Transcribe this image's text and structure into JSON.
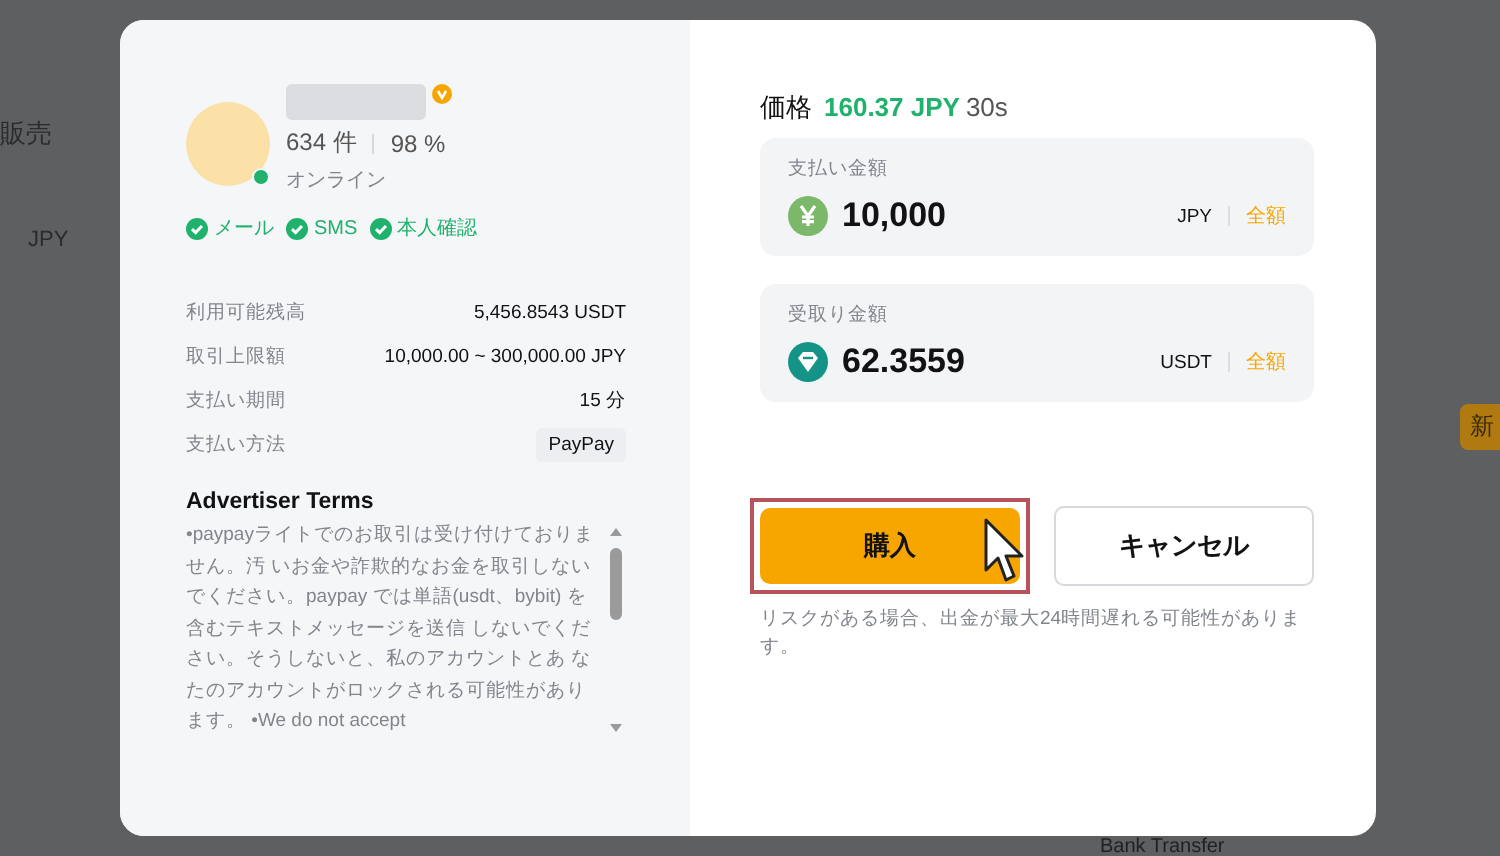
{
  "background_page": {
    "sell_tab": "販売",
    "currency": "JPY",
    "new_tag": "新",
    "payment_label": "Bank Transfer"
  },
  "advertiser": {
    "verified_badge": true,
    "online": true,
    "orders": "634 件",
    "completion": "98 %",
    "status": "オンライン",
    "verifications": [
      {
        "label": "メール",
        "verified": true
      },
      {
        "label": "SMS",
        "verified": true
      },
      {
        "label": "本人確認",
        "verified": true
      }
    ]
  },
  "details": [
    {
      "label": "利用可能残高",
      "value": "5,456.8543 USDT",
      "kind": "text"
    },
    {
      "label": "取引上限額",
      "value": "10,000.00 ~ 300,000.00 JPY",
      "kind": "text"
    },
    {
      "label": "支払い期間",
      "value": "15 分",
      "kind": "text"
    },
    {
      "label": "支払い方法",
      "value": "PayPay",
      "kind": "tag"
    }
  ],
  "terms": {
    "title": "Advertiser Terms",
    "text": "•paypayライトでのお取引は受け付けておりません。汚 いお金や詐欺的なお金を取引しないでください。paypay では単語(usdt、bybit) を含むテキストメッセージを送信 しないでください。そうしないと、私のアカウントとあ なたのアカウントがロックされる可能性があります。 •We do not accept"
  },
  "price": {
    "label": "価格",
    "value": "160.37 JPY",
    "countdown": "30s"
  },
  "amounts": [
    {
      "label": "支払い金額",
      "value": "10,000",
      "currency": "JPY",
      "max": "全額",
      "kind": "yen"
    },
    {
      "label": "受取り金額",
      "value": "62.3559",
      "currency": "USDT",
      "max": "全額",
      "kind": "usdt"
    }
  ],
  "buy_button": {
    "label": "購入",
    "highlighted": true
  },
  "cancel_button": {
    "label": "キャンセル"
  },
  "note": "リスクがある場合、出金が最大24時間遅れる可能性があります。"
}
